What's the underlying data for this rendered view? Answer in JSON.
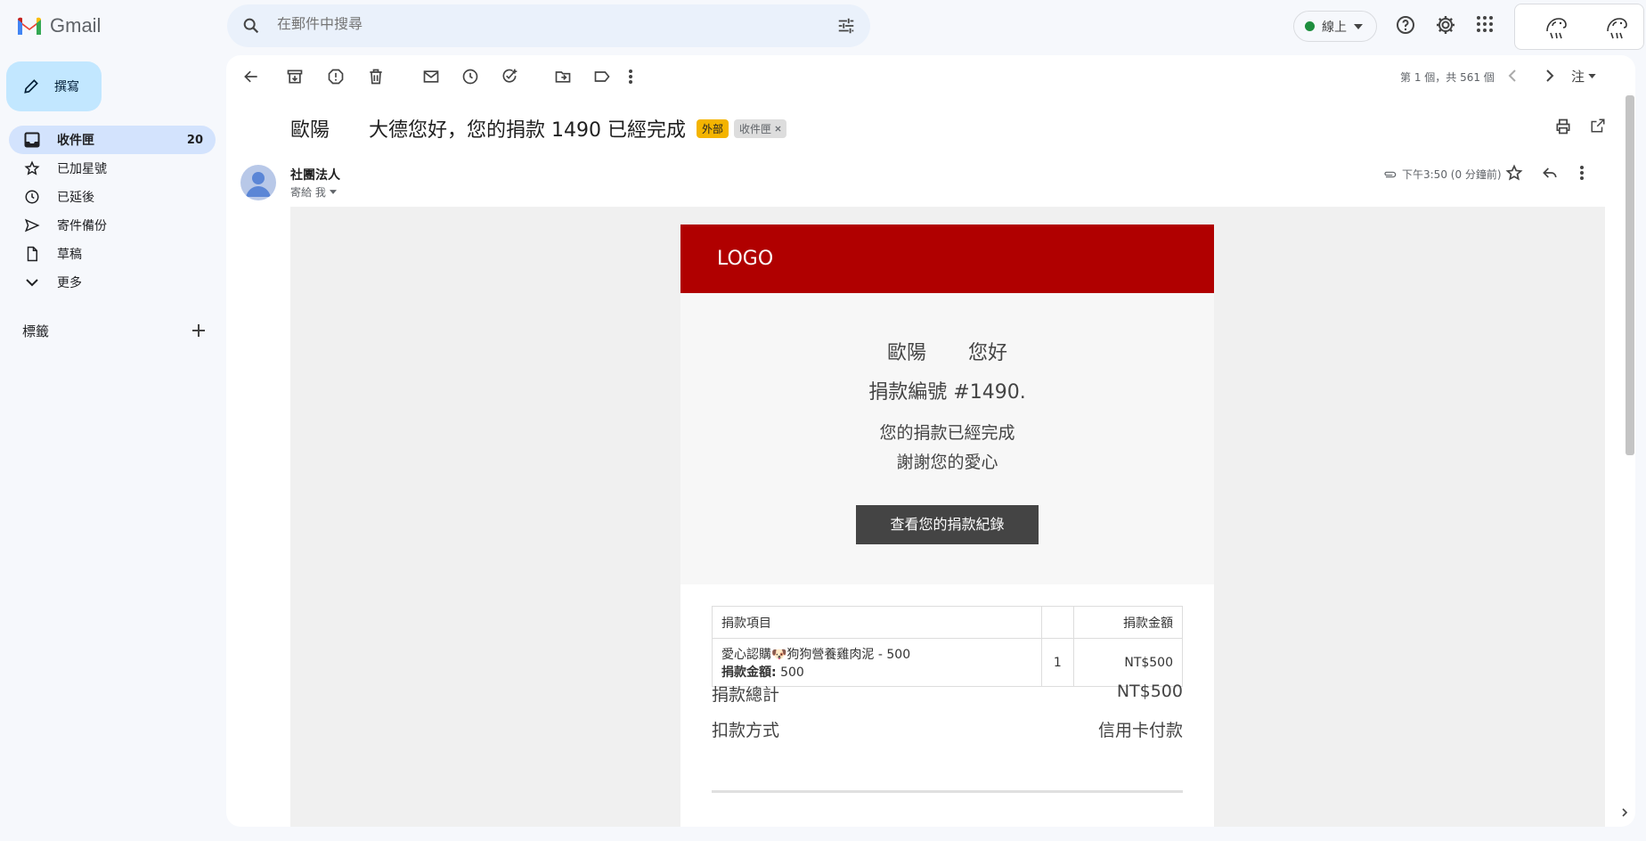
{
  "app": {
    "name": "Gmail"
  },
  "search": {
    "placeholder": "在郵件中搜尋"
  },
  "status": {
    "label": "線上"
  },
  "sidebar": {
    "compose_label": "撰寫",
    "items": [
      {
        "label": "收件匣",
        "count": "20",
        "icon": "inbox-icon"
      },
      {
        "label": "已加星號",
        "icon": "star-icon"
      },
      {
        "label": "已延後",
        "icon": "clock-icon"
      },
      {
        "label": "寄件備份",
        "icon": "send-icon"
      },
      {
        "label": "草稿",
        "icon": "draft-icon"
      },
      {
        "label": "更多",
        "icon": "chevron-down-icon"
      }
    ],
    "labels_heading": "標籤"
  },
  "toolbar": {
    "pager": "第 1 個，共 561 個",
    "input_tool": "注"
  },
  "message": {
    "subject": "歐陽　　大德您好，您的捐款 1490 已經完成",
    "badge_external": "外部",
    "badge_inbox": "收件匣",
    "sender": "社團法人",
    "to": "寄給 我",
    "time": "下午3:50 (0 分鐘前)"
  },
  "email": {
    "logo": "LOGO",
    "greeting": "歐陽 您好",
    "order_no": "捐款編號 #1490.",
    "done": "您的捐款已經完成",
    "thanks": "謝謝您的愛心",
    "button": "查看您的捐款紀錄",
    "table": {
      "col_item": "捐款項目",
      "col_amount": "捐款金額",
      "row_item": "愛心認購🐶狗狗營養雞肉泥 - 500",
      "row_sub_label": "捐款金額:",
      "row_sub_value": "500",
      "row_qty": "1",
      "row_amount": "NT$500"
    },
    "total_label": "捐款總計",
    "total_value": "NT$500",
    "payment_label": "扣款方式",
    "payment_value": "信用卡付款"
  },
  "colors": {
    "brand_red": "#b00000",
    "accent_blue": "#c2e7ff",
    "external_badge": "#f4b400"
  }
}
